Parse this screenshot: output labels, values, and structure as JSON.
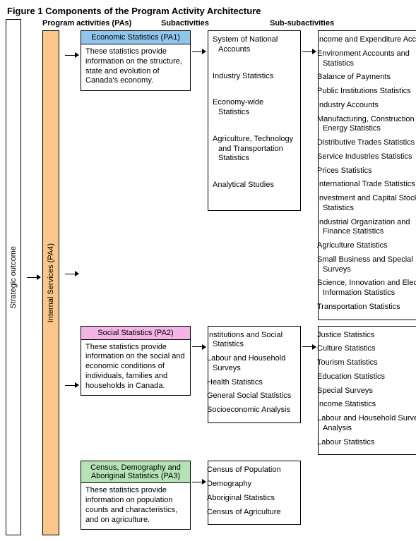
{
  "figure_title": "Figure 1   Components of the Program Activity Architecture",
  "headers": {
    "pa": "Program activities (PAs)",
    "sub": "Subactivities",
    "subsub": "Sub-subactivities"
  },
  "strategic_label": "Strategic outcome",
  "internal_label": "Internal Services (PA4)",
  "rows": [
    {
      "id": "pa1",
      "header_color": "blue",
      "title": "Economic Statistics (PA1)",
      "desc": "These statistics provide information on the structure, state and evolution of Canada's economy.",
      "sub": [
        "System of National Accounts",
        "Industry Statistics",
        "Economy-wide Statistics",
        "Agriculture, Technology and Transportation Statistics",
        "Analytical Studies"
      ],
      "subsub": [
        "Income and Expenditure Accounts",
        "Environment Accounts and Statistics",
        "Balance of Payments",
        "Public Institutions Statistics",
        "Industry Accounts",
        "Manufacturing, Construction and Energy Statistics",
        "Distributive Trades Statistics",
        "Service Industries Statistics",
        "Prices Statistics",
        "International Trade Statistics",
        "Investment and Capital Stock Statistics",
        "Industrial Organization and Finance Statistics",
        "Agriculture Statistics",
        "Small Business and Special Surveys",
        "Science, Innovation and Electronic Information Statistics",
        "Transportation Statistics"
      ]
    },
    {
      "id": "pa2",
      "header_color": "pink",
      "title": "Social Statistics (PA2)",
      "desc": "These statistics provide information on the social and economic conditions of individuals, families and households in Canada.",
      "sub": [
        "Institutions and Social Statistics",
        "Labour and Household Surveys",
        "Health Statistics",
        "General Social Statistics",
        "Socioeconomic Analysis"
      ],
      "subsub": [
        "Justice Statistics",
        "Culture Statistics",
        "Tourism Statistics",
        "Education Statistics",
        "Special Surveys",
        "Income Statistics",
        "Labour and Household Surveys Analysis",
        "Labour Statistics"
      ]
    },
    {
      "id": "pa3",
      "header_color": "green",
      "title": "Census, Demography and Aboriginal Statistics (PA3)",
      "desc": "These statistics provide information on population counts and characteristics, and on agriculture.",
      "sub": [
        "Census of Population",
        "Demography",
        "Aboriginal Statistics",
        "Census of Agriculture"
      ],
      "subsub": []
    }
  ]
}
